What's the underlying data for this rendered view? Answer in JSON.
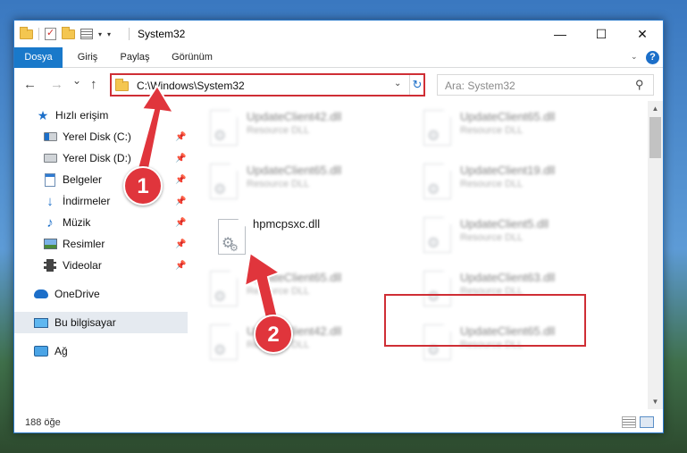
{
  "window": {
    "title": "System32",
    "controls": {
      "minimize": "—",
      "maximize": "☐",
      "close": "✕"
    }
  },
  "ribbon": {
    "tabs": [
      {
        "label": "Dosya",
        "active": true
      },
      {
        "label": "Giriş"
      },
      {
        "label": "Paylaş"
      },
      {
        "label": "Görünüm"
      }
    ],
    "help": "?"
  },
  "navigation": {
    "back": "←",
    "forward": "→",
    "recent": "⌄",
    "up": "↑",
    "address": "C:\\Windows\\System32",
    "refresh": "↻",
    "search_placeholder": "Ara: System32"
  },
  "sidebar": {
    "items": [
      {
        "label": "Hızlı erişim",
        "icon": "star-icon"
      },
      {
        "label": "Yerel Disk (C:)",
        "icon": "drive-icon",
        "pinned": true
      },
      {
        "label": "Yerel Disk (D:)",
        "icon": "drive-icon",
        "pinned": true
      },
      {
        "label": "Belgeler",
        "icon": "documents-icon",
        "pinned": true
      },
      {
        "label": "İndirmeler",
        "icon": "downloads-icon",
        "pinned": true
      },
      {
        "label": "Müzik",
        "icon": "music-icon",
        "pinned": true
      },
      {
        "label": "Resimler",
        "icon": "pictures-icon",
        "pinned": true
      },
      {
        "label": "Videolar",
        "icon": "videos-icon",
        "pinned": true
      },
      {
        "label": "OneDrive",
        "icon": "onedrive-icon"
      },
      {
        "label": "Bu bilgisayar",
        "icon": "this-pc-icon",
        "selected": true
      },
      {
        "label": "Ağ",
        "icon": "network-icon"
      }
    ]
  },
  "files": [
    {
      "name": "UpdateClient42.dll",
      "type": "Resource DLL",
      "blurred": true
    },
    {
      "name": "UpdateClient65.dll",
      "type": "Resource DLL",
      "blurred": true
    },
    {
      "name": "UpdateClient65.dll",
      "type": "Resource DLL",
      "blurred": true
    },
    {
      "name": "UpdateClient19.dll",
      "type": "Resource DLL",
      "blurred": true
    },
    {
      "name": "hpmcpsxc.dll",
      "type": "",
      "blurred": false,
      "highlighted": true
    },
    {
      "name": "UpdateClient5.dll",
      "type": "Resource DLL",
      "blurred": true
    },
    {
      "name": "UpdateClient65.dll",
      "type": "Resource DLL",
      "blurred": true
    },
    {
      "name": "UpdateClient63.dll",
      "type": "Resource DLL",
      "blurred": true
    },
    {
      "name": "UpdateClient42.dll",
      "type": "Resource DLL",
      "blurred": true
    },
    {
      "name": "UpdateClient65.dll",
      "type": "Resource DLL",
      "blurred": true
    }
  ],
  "status": {
    "item_count": "188 öğe"
  },
  "callouts": [
    "1",
    "2"
  ],
  "colors": {
    "accent": "#1979ca",
    "callout": "#e0353c",
    "highlight_border": "#cf2e35"
  }
}
